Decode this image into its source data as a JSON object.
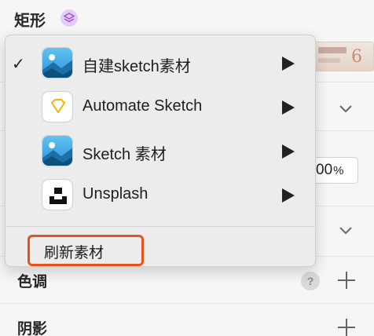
{
  "panel": {
    "title": "矩形",
    "opacity_value": "00",
    "opacity_sign": "%",
    "sections": {
      "tint": "色调",
      "shadow": "阴影"
    },
    "help_glyph": "?"
  },
  "menu": {
    "items": [
      {
        "label": "自建sketch素材",
        "checked": true,
        "check_glyph": "✓",
        "icon": "image-landscape-icon"
      },
      {
        "label": "Automate Sketch",
        "checked": false,
        "icon": "sketch-diamond-icon"
      },
      {
        "label": "Sketch 素材",
        "checked": false,
        "icon": "image-landscape-icon"
      },
      {
        "label": "Unsplash",
        "checked": false,
        "icon": "unsplash-icon"
      }
    ],
    "refresh_label": "刷新素材",
    "highlight_color": "#e5531a"
  },
  "thumbnail": {
    "visible_number": "6"
  }
}
